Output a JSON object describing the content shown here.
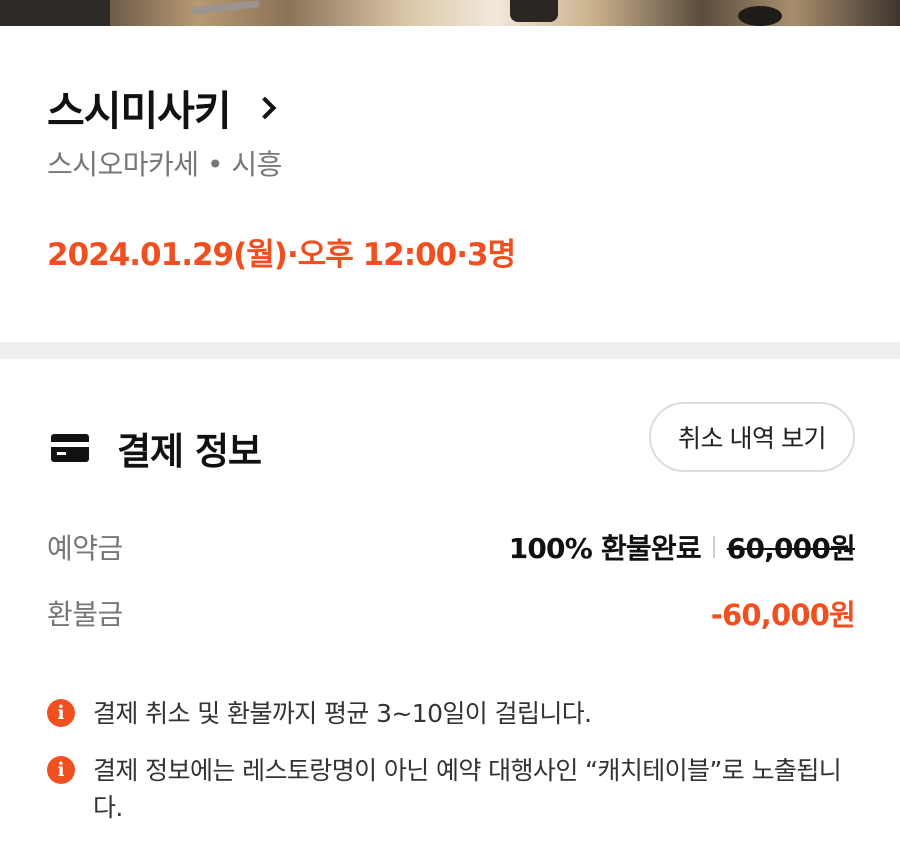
{
  "restaurant": {
    "name": "스시미사키",
    "subtitle": "스시오마카세 • 시흥",
    "reservation": "2024.01.29(월)·오후 12:00·3명"
  },
  "payment": {
    "title": "결제 정보",
    "history_button": "취소 내역 보기",
    "rows": [
      {
        "label": "예약금",
        "status": "100% 환불완료",
        "original_price": "60,000원"
      },
      {
        "label": "환불금",
        "amount": "-60,000원"
      }
    ],
    "notices": [
      "결제 취소 및 환불까지 평균 3~10일이 걸립니다.",
      "결제 정보에는 레스토랑명이 아닌 예약 대행사인 “캐치테이블”로 노출됩니다."
    ]
  },
  "colors": {
    "accent": "#f0501f",
    "divider": "#efefef",
    "text_secondary": "#777777"
  },
  "icons": {
    "chevron": "chevron-right-icon",
    "card": "credit-card-icon",
    "info": "info-icon"
  }
}
